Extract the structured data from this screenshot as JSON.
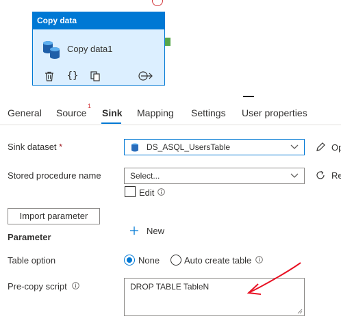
{
  "activity": {
    "header_title": "Copy data",
    "name": "Copy data1",
    "toolbar": {
      "delete_icon": "trash-icon",
      "code_icon": "braces-icon",
      "copy_icon": "copy-icon",
      "output_icon": "arrow-right-circle-icon",
      "code_glyph": "{}"
    }
  },
  "tabs": [
    {
      "label": "General"
    },
    {
      "label": "Source",
      "badge": "1"
    },
    {
      "label": "Sink",
      "active": true
    },
    {
      "label": "Mapping"
    },
    {
      "label": "Settings"
    },
    {
      "label": "User properties"
    }
  ],
  "sink": {
    "dataset_label": "Sink dataset",
    "required_mark": "*",
    "dataset_value": "DS_ASQL_UsersTable",
    "open_link": "Op",
    "stored_proc_label": "Stored procedure name",
    "stored_proc_placeholder": "Select...",
    "refresh_link": "Re",
    "edit_label": "Edit",
    "import_parameter_button": "Import parameter",
    "parameter_label": "Parameter",
    "new_button": "New",
    "table_option_label": "Table option",
    "table_option_none": "None",
    "table_option_auto": "Auto create table",
    "precopy_label": "Pre-copy script",
    "precopy_value": "DROP TABLE TableN"
  },
  "colors": {
    "accent": "#0078d4",
    "activity_bg": "#dcefff",
    "success": "#57a64a",
    "error": "#d13438",
    "annotation": "#e81123"
  }
}
